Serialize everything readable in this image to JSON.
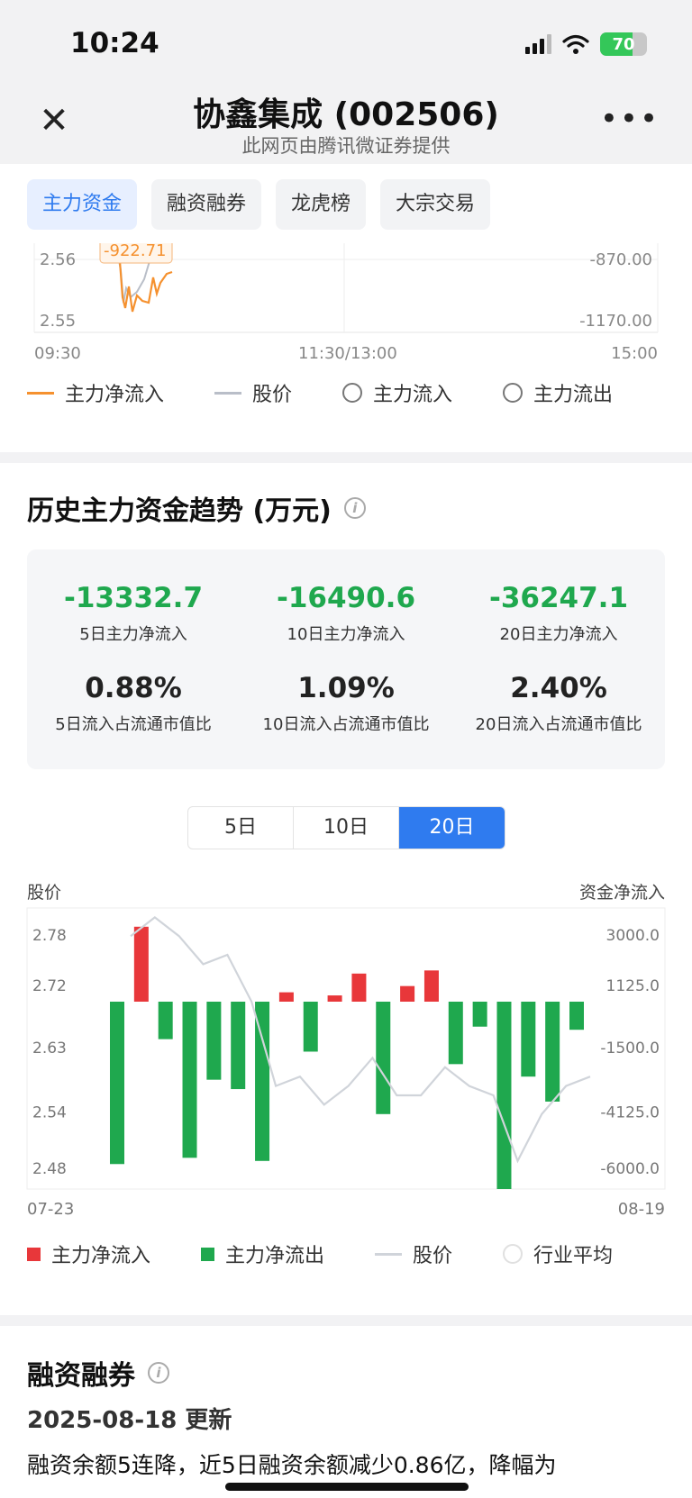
{
  "status": {
    "time": "10:24",
    "battery": "70",
    "battery_level": 70
  },
  "nav": {
    "title": "协鑫集成 (002506)",
    "subtitle": "此网页由腾讯微证券提供"
  },
  "tabs": [
    {
      "label": "主力资金",
      "active": true
    },
    {
      "label": "融资融券",
      "active": false
    },
    {
      "label": "龙虎榜",
      "active": false
    },
    {
      "label": "大宗交易",
      "active": false
    }
  ],
  "intraday": {
    "y_left": [
      "2.56",
      "2.55"
    ],
    "y_right": [
      "-870.00",
      "-1170.00"
    ],
    "x_labels": [
      "09:30",
      "11:30/13:00",
      "15:00"
    ],
    "tooltip": "-922.71",
    "legend": [
      {
        "label": "主力净流入",
        "style": "line",
        "color": "#f5912f"
      },
      {
        "label": "股价",
        "style": "line",
        "color": "#b9bec8"
      },
      {
        "label": "主力流入",
        "style": "circle"
      },
      {
        "label": "主力流出",
        "style": "circle"
      }
    ]
  },
  "history": {
    "title": "历史主力资金趋势 (万元)",
    "stats": [
      {
        "value": "-13332.7",
        "label": "5日主力净流入"
      },
      {
        "value": "-16490.6",
        "label": "10日主力净流入"
      },
      {
        "value": "-36247.1",
        "label": "20日主力净流入"
      },
      {
        "value": "0.88%",
        "label": "5日流入占流通市值比"
      },
      {
        "value": "1.09%",
        "label": "10日流入占流通市值比"
      },
      {
        "value": "2.40%",
        "label": "20日流入占流通市值比"
      }
    ],
    "periods": [
      {
        "label": "5日",
        "active": false
      },
      {
        "label": "10日",
        "active": false
      },
      {
        "label": "20日",
        "active": true
      }
    ],
    "left_axis_title": "股价",
    "right_axis_title": "资金净流入",
    "legend": [
      {
        "label": "主力净流入",
        "style": "square",
        "color": "#e8373a"
      },
      {
        "label": "主力净流出",
        "style": "square",
        "color": "#1fa84e"
      },
      {
        "label": "股价",
        "style": "line",
        "color": "#d0d4da"
      },
      {
        "label": "行业平均",
        "style": "circle"
      }
    ]
  },
  "chart_data": {
    "type": "bar",
    "x_start": "07-23",
    "x_end": "08-19",
    "y_left_ticks": [
      "2.78",
      "2.72",
      "2.63",
      "2.54",
      "2.48"
    ],
    "y_right_ticks": [
      "3000.0",
      "1125.0",
      "-1500.0",
      "-4125.0",
      "-6000.0"
    ],
    "ylim_left": [
      2.48,
      2.78
    ],
    "ylim_right": [
      -6000,
      3000
    ],
    "colors": {
      "inflow": "#e8373a",
      "outflow": "#1fa84e",
      "price": "#d0d4da"
    },
    "series": [
      {
        "name": "主力资金",
        "values": [
          -5200,
          2400,
          -1200,
          -5000,
          -2500,
          -2800,
          -5100,
          300,
          -1600,
          200,
          900,
          -3600,
          500,
          1000,
          -2000,
          -800,
          -6000,
          -2400,
          -3200,
          -900
        ]
      },
      {
        "name": "股价",
        "values": [
          2.75,
          2.77,
          2.75,
          2.72,
          2.73,
          2.68,
          2.59,
          2.6,
          2.57,
          2.59,
          2.62,
          2.58,
          2.58,
          2.61,
          2.59,
          2.58,
          2.51,
          2.56,
          2.59,
          2.6
        ]
      }
    ]
  },
  "margin": {
    "title": "融资融券",
    "date": "2025-08-18 更新",
    "text": "融资余额5连降，近5日融资余额减少0.86亿，降幅为"
  }
}
